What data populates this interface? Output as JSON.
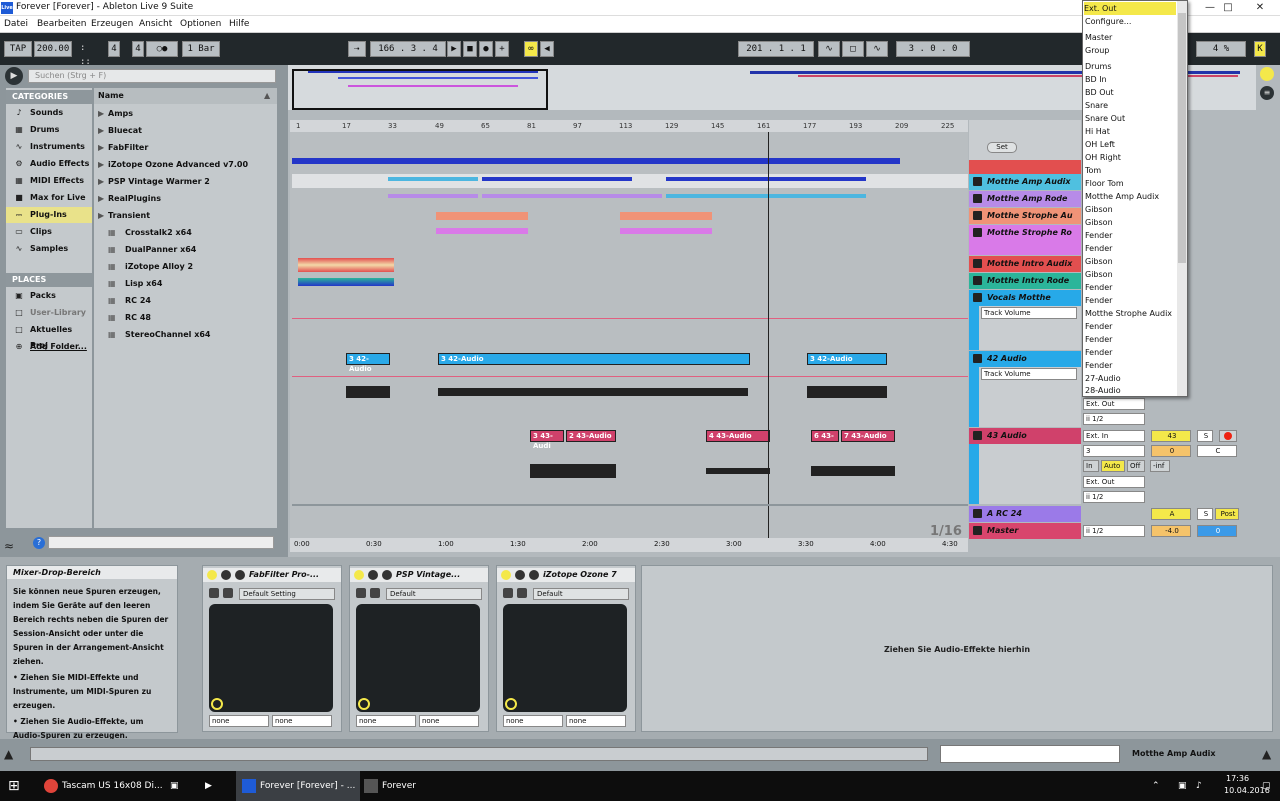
{
  "window": {
    "title": "Forever  [Forever] - Ableton Live 9 Suite",
    "logo": "Live",
    "controls": [
      "minimize-icon",
      "maximize-icon",
      "close-icon"
    ]
  },
  "menu": [
    "Datei",
    "Bearbeiten",
    "Erzeugen",
    "Ansicht",
    "Optionen",
    "Hilfe"
  ],
  "transport": {
    "tap": "TAP",
    "tempo": "200.00",
    "signature_num": "4",
    "signature_den": "4",
    "metronome": "○●",
    "quantize": "1 Bar",
    "position": "166 .  3 .  4",
    "loop_start": "201 .  1 .  1",
    "loop_length": "3 .  0 .  0",
    "cpu": "4 %",
    "key": "K",
    "d": "D"
  },
  "browser": {
    "search_placeholder": "Suchen (Strg + F)",
    "categories_title": "CATEGORIES",
    "categories": [
      "Sounds",
      "Drums",
      "Instruments",
      "Audio Effects",
      "MIDI Effects",
      "Max for Live",
      "Plug-Ins",
      "Clips",
      "Samples"
    ],
    "places_title": "PLACES",
    "places": [
      "Packs",
      "User-Library",
      "Aktuelles Proj",
      "Add Folder..."
    ],
    "column_header": "Name",
    "folders": [
      "Amps",
      "Bluecat",
      "FabFilter",
      "iZotope Ozone Advanced v7.00",
      "PSP Vintage Warmer 2",
      "RealPlugins",
      "Transient"
    ],
    "plugins": [
      "Crosstalk2 x64",
      "DualPanner x64",
      "iZotope Alloy 2",
      "Lisp x64",
      "RC 24",
      "RC 48",
      "StereoChannel x64"
    ]
  },
  "ruler": [
    "1",
    "17",
    "33",
    "49",
    "65",
    "81",
    "97",
    "113",
    "129",
    "145",
    "161",
    "177",
    "193",
    "209",
    "225"
  ],
  "timeline": [
    "0:00",
    "0:30",
    "1:00",
    "1:30",
    "2:00",
    "2:30",
    "3:00",
    "3:30",
    "4:00",
    "4:30"
  ],
  "grid": "1/16",
  "set_label": "Set",
  "tracks": [
    {
      "name": "Motthe Amp Audix",
      "color": "#4fc0e0"
    },
    {
      "name": "Motthe Amp Rode",
      "color": "#b78be8"
    },
    {
      "name": "Motthe Strophe Au",
      "color": "#f09377"
    },
    {
      "name": "Motthe Strophe Ro",
      "color": "#d97ae8"
    },
    {
      "name": "Motthe Intro Audix",
      "color": "#e24f4f"
    },
    {
      "name": "Motthe Intro Rode",
      "color": "#2bb59a"
    },
    {
      "name": "Vocals Motthe",
      "color": "#27a9e8"
    },
    {
      "name": "42 Audio",
      "color": "#27a9e8"
    },
    {
      "name": "43 Audio",
      "color": "#d0416b"
    },
    {
      "name": "A RC 24",
      "color": "#9b7ae8"
    },
    {
      "name": "Master",
      "color": "#d8456d"
    }
  ],
  "automation": [
    "Track Volume",
    "Track Volume"
  ],
  "clips_42": [
    "3 42-Audio",
    "3 42-Audio",
    "3 42-Audio"
  ],
  "clips_43": [
    "3 43-Audi",
    "2 43-Audio",
    "4 43-Audio",
    "6 43-",
    "7 43-Audio"
  ],
  "mixer": {
    "ext_out": "Ext. Out",
    "ext_in": "Ext. In",
    "channel_in": "3",
    "ii_half": "ii 1/2",
    "track43_num": "43",
    "track43_vol": "0",
    "in": "In",
    "auto": "Auto",
    "off": "Off",
    "inf": "-inf",
    "return_a": "A",
    "s": "S",
    "post": "Post",
    "master_vol": "-4.0",
    "master_pan": "0",
    "c": "C"
  },
  "dropdown": [
    "Ext. Out",
    "Configure...",
    "Master",
    "Group",
    "Drums",
    "BD In",
    "BD Out",
    "Snare",
    "Snare Out",
    "Hi Hat",
    "OH Left",
    "OH Right",
    "Tom",
    "Floor Tom",
    "Motthe Amp Audix",
    "Gibson",
    "Gibson",
    "Fender",
    "Fender",
    "Gibson",
    "Gibson",
    "Fender",
    "Fender",
    "Motthe Strophe Audix",
    "Fender",
    "Fender",
    "Fender",
    "Fender",
    "27-Audio",
    "28-Audio"
  ],
  "info": {
    "title": "Mixer-Drop-Bereich",
    "body": "Sie können neue Spuren erzeugen, indem Sie Geräte auf den leeren Bereich rechts neben die Spuren der Session-Ansicht oder unter die Spuren in der Arrangement-Ansicht ziehen.",
    "bullet1": "Ziehen Sie MIDI-Effekte und Instrumente, um MIDI-Spuren zu erzeugen.",
    "bullet2": "Ziehen Sie Audio-Effekte, um Audio-Spuren zu erzeugen."
  },
  "devices": [
    {
      "name": "FabFilter Pro-...",
      "preset": "Default Setting",
      "sel1": "none",
      "sel2": "none"
    },
    {
      "name": "PSP Vintage...",
      "preset": "Default",
      "sel1": "none",
      "sel2": "none"
    },
    {
      "name": "iZotope Ozone 7",
      "preset": "Default",
      "sel1": "none",
      "sel2": "none"
    }
  ],
  "drop_hint": "Ziehen Sie Audio-Effekte hierhin",
  "status_track": "Motthe Amp Audix",
  "taskbar": {
    "items": [
      "Tascam US 16x08 Di...",
      "Forever  [Forever] - ...",
      "Forever"
    ],
    "time": "17:36",
    "date": "10.04.2016"
  }
}
